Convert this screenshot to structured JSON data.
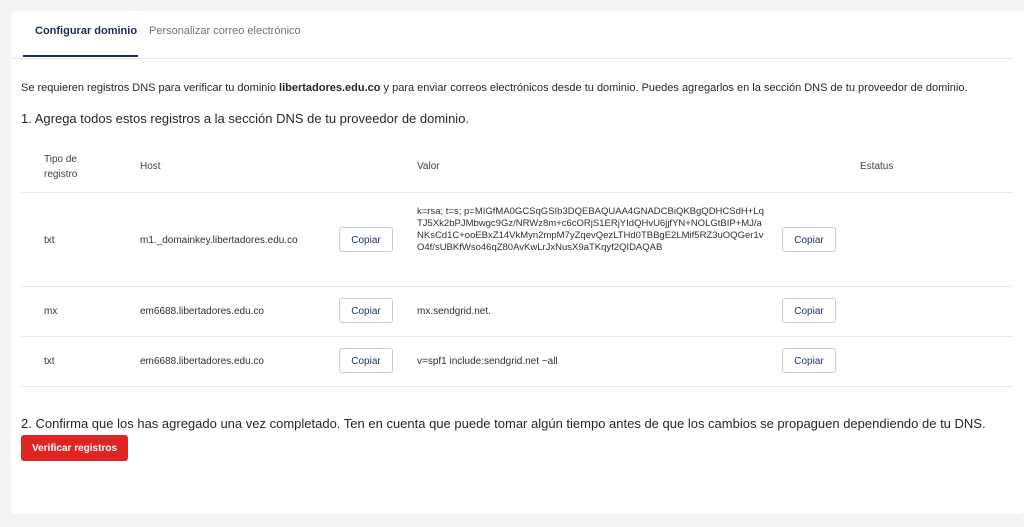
{
  "tabs": [
    {
      "label": "Configurar dominio",
      "active": true
    },
    {
      "label": "Personalizar correo electrónico",
      "active": false
    }
  ],
  "intro": {
    "before": "Se requieren registros DNS para verificar tu dominio ",
    "domain": "libertadores.edu.co",
    "after": " y para enviar correos electrónicos desde tu dominio. Puedes agregarlos en la sección DNS de tu proveedor de dominio."
  },
  "step1": "1. Agrega todos estos registros a la sección DNS de tu proveedor de dominio.",
  "table": {
    "headers": {
      "tipo_line1": "Tipo de",
      "tipo_line2": "registro",
      "host": "Host",
      "valor": "Valor",
      "estatus": "Estatus"
    },
    "copy_label": "Copiar",
    "rows": [
      {
        "tipo": "txt",
        "host": "m1._domainkey.libertadores.edu.co",
        "valor": "k=rsa; t=s; p=MIGfMA0GCSqGSIb3DQEBAQUAA4GNADCBiQKBgQDHCSdH+LqTJ5Xk2bPJMbwgc9Gz/NRWz8m+c6cORjS1ERjYIdQHvU6jjfYN+NOLGtBIP+MJ/aNKsCd1C+ooEBxZ14VkMyn2mpM7yZqevQezLTHd0TBBgE2LMif5RZ3uOQGer1vO4f/sUBKfWso46qZ80AvKwLrJxNusX9aTKqyf2QIDAQAB",
        "estatus": ""
      },
      {
        "tipo": "mx",
        "host": "em6688.libertadores.edu.co",
        "valor": "mx.sendgrid.net.",
        "estatus": ""
      },
      {
        "tipo": "txt",
        "host": "em6688.libertadores.edu.co",
        "valor": "v=spf1 include:sendgrid.net ~all",
        "estatus": ""
      }
    ]
  },
  "step2": "2. Confirma que los has agregado una vez completado. Ten en cuenta que puede tomar algún tiempo antes de que los cambios se propaguen dependiendo de tu DNS.",
  "verify_label": "Verificar registros",
  "colors": {
    "accent": "#1a2d55",
    "danger": "#e02424"
  }
}
